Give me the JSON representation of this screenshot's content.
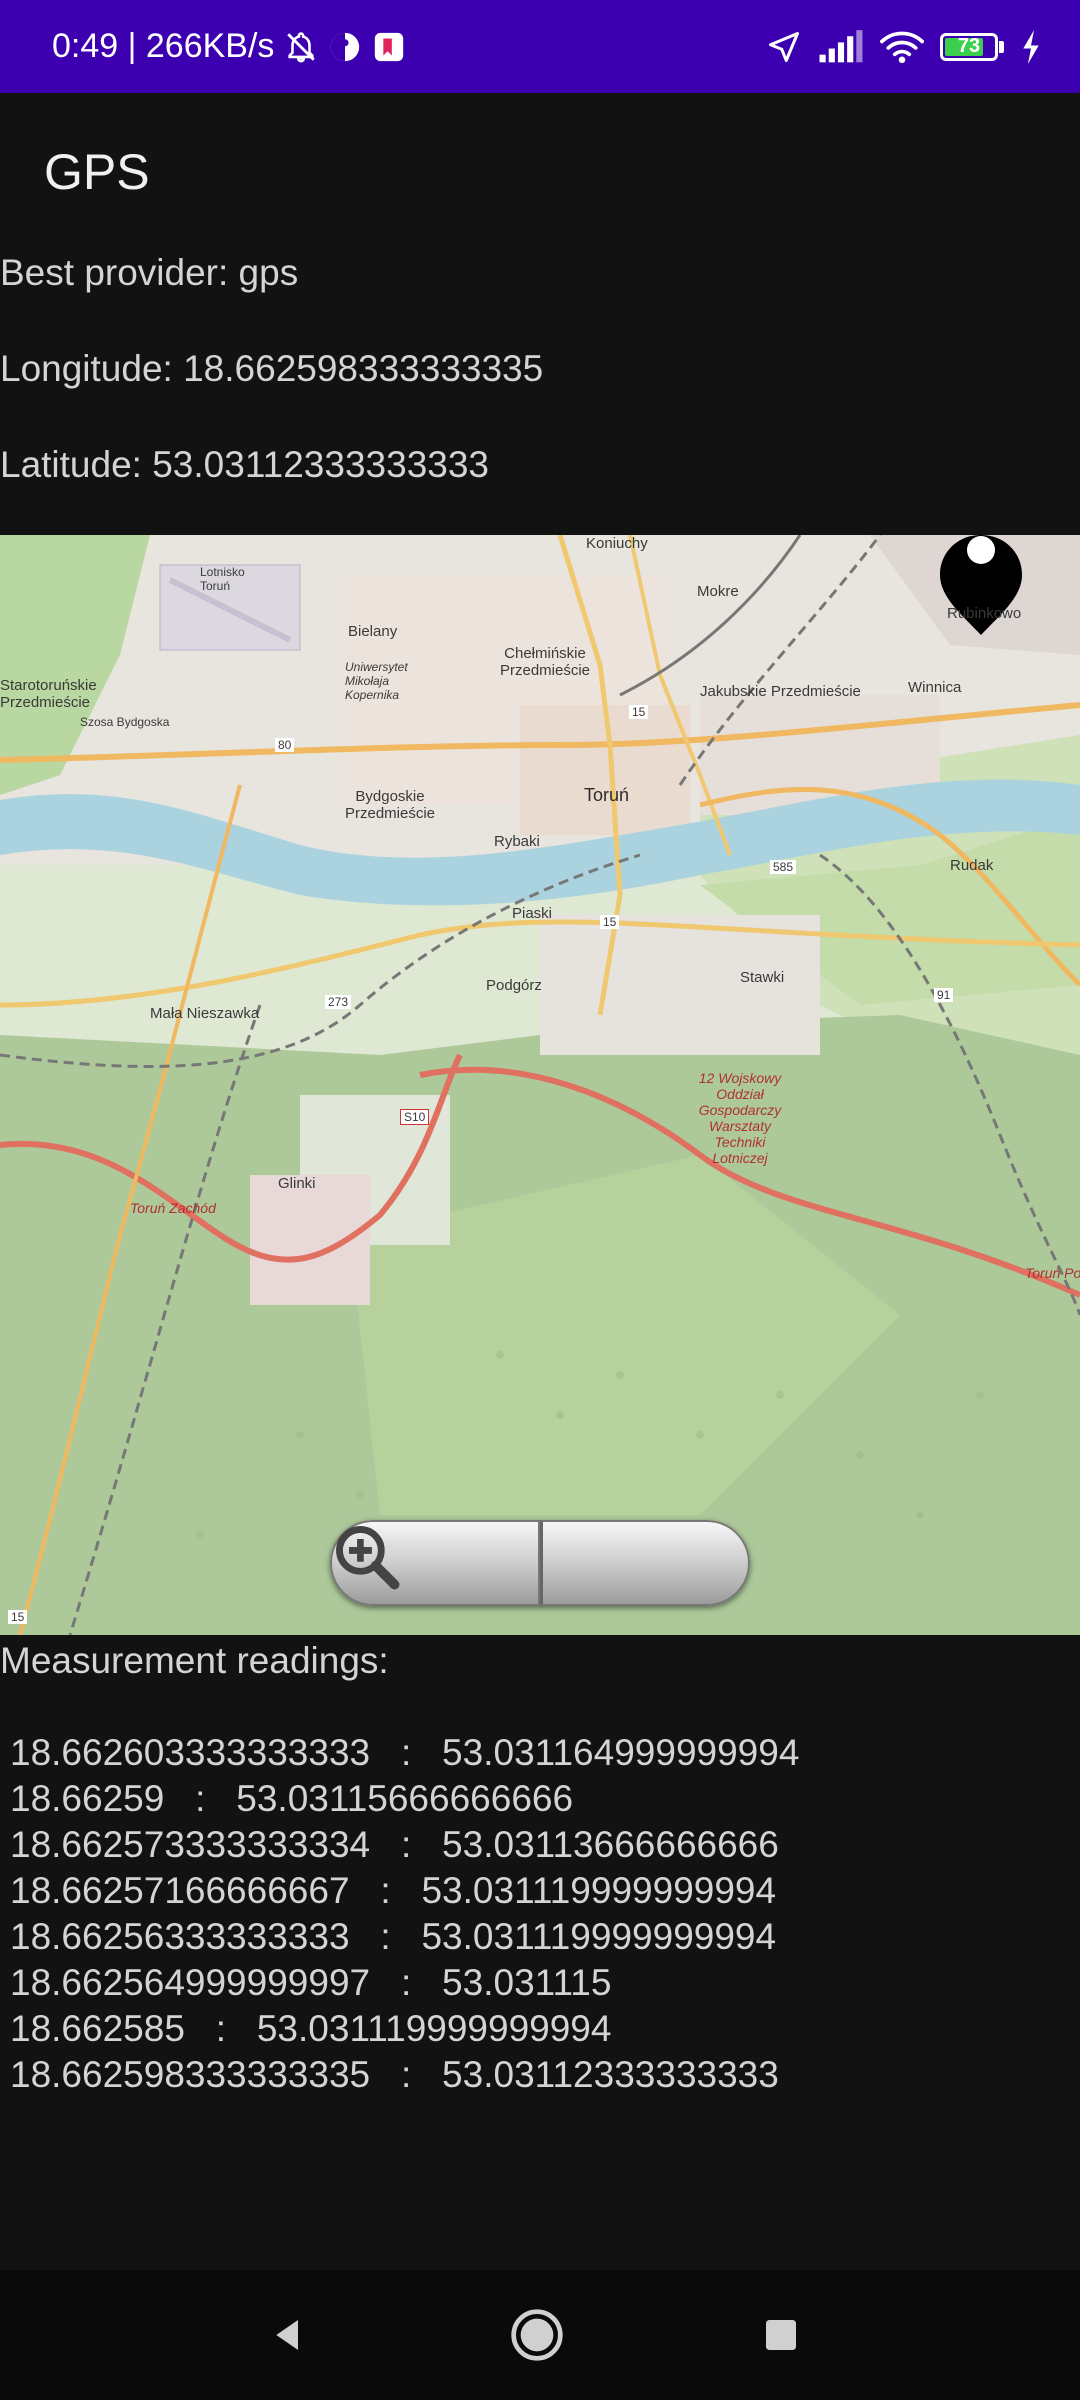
{
  "status_bar": {
    "time_speed": "0:49 | 266KB/s",
    "battery_level": "73",
    "icons": [
      "bell-off-icon",
      "app-icon",
      "youtube-icon",
      "location-icon",
      "signal-icon",
      "wifi-icon",
      "battery-icon",
      "charging-icon"
    ]
  },
  "app": {
    "title": "GPS"
  },
  "info": {
    "best_provider": "Best provider: gps",
    "longitude": "Longitude: 18.662598333333335",
    "latitude": "Latitude: 53.03112333333333"
  },
  "map": {
    "labels": {
      "koniuchy": "Koniuchy",
      "lotnisko": "Lotnisko Toruń",
      "mokre": "Mokre",
      "rubinkowo": "Rubinkowo",
      "bielany": "Bielany",
      "chelminskie": "Chełmińskie Przedmieście",
      "uniwersytet": "Uniwersytet Mikołaja Kopernika",
      "jakubskie": "Jakubskie Przedmieście",
      "winnica": "Winnica",
      "starotorunskie": "Starotoruńskie Przedmieście",
      "szosa": "Szosa Bydgoska",
      "bydgoskie": "Bydgoskie Przedmieście",
      "torun": "Toruń",
      "rybaki": "Rybaki",
      "rudak": "Rudak",
      "piaski": "Piaski",
      "podgorz": "Podgórz",
      "stawki": "Stawki",
      "mala_nieszawka": "Mała Nieszawka",
      "wojskowy": "12 Wojskowy Oddział Gospodarczy Warsztaty Techniki Lotniczej",
      "glinki": "Glinki",
      "torun_zachod": "Toruń Zachód",
      "torun_pol": "Toruń Połu...",
      "r80": "80",
      "r15": "15",
      "r15b": "15",
      "r15c": "15",
      "r273": "273",
      "r585": "585",
      "r91": "91",
      "s10": "S10"
    }
  },
  "zoom": {
    "out": "zoom-out-icon",
    "in": "zoom-in-icon"
  },
  "readings": {
    "title": "Measurement readings:",
    "rows": [
      "18.662603333333333   :   53.031164999999994",
      "18.66259   :   53.03115666666666",
      "18.662573333333334   :   53.03113666666666",
      "18.66257166666667   :   53.031119999999994",
      "18.66256333333333   :   53.031119999999994",
      "18.662564999999997   :   53.031115",
      "18.662585   :   53.031119999999994",
      "18.662598333333335   :   53.03112333333333"
    ]
  },
  "navbar": {
    "back": "back-icon",
    "home": "home-icon",
    "recents": "recents-icon"
  }
}
